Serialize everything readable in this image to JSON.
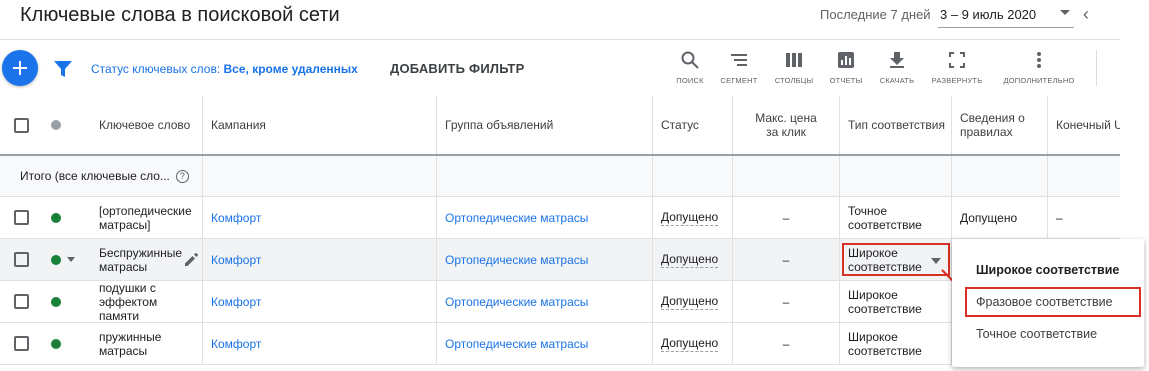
{
  "header": {
    "title": "Ключевые слова в поисковой сети",
    "date_range_label": "Последние 7 дней",
    "date_range_value": "3 – 9 июль 2020"
  },
  "toolbar": {
    "status_label": "Статус ключевых слов: ",
    "status_value": "Все, кроме удаленных",
    "add_filter": "ДОБАВИТЬ ФИЛЬТР",
    "tools": [
      "ПОИСК",
      "СЕГМЕНТ",
      "СТОЛБЦЫ",
      "ОТЧЕТЫ",
      "СКАЧАТЬ",
      "РАЗВЕРНУТЬ",
      "ДОПОЛНИТЕЛЬНО"
    ]
  },
  "table": {
    "headers": {
      "keyword": "Ключевое слово",
      "campaign": "Кампания",
      "ad_group": "Группа объявлений",
      "status": "Статус",
      "max_cpc": "Макс. цена за клик",
      "match_type": "Тип соответствия",
      "policy": "Сведения о правилах",
      "final_url": "Конечный U"
    },
    "total_label": "Итого (все ключевые сло...",
    "rows": [
      {
        "keyword": "[ортопедические матрасы]",
        "campaign": "Комфорт",
        "ad_group": "Ортопедические матрасы",
        "status": "Допущено",
        "max_cpc": "–",
        "match_type": "Точное соответствие",
        "policy": "Допущено",
        "final_url": "–"
      },
      {
        "keyword": "Беспружинные матрасы",
        "campaign": "Комфорт",
        "ad_group": "Ортопедические матрасы",
        "status": "Допущено",
        "max_cpc": "–",
        "match_type": "Широкое соответствие",
        "policy": "",
        "final_url": ""
      },
      {
        "keyword": "подушки с эффектом памяти",
        "campaign": "Комфорт",
        "ad_group": "Ортопедические матрасы",
        "status": "Допущено",
        "max_cpc": "–",
        "match_type": "Широкое соответствие",
        "policy": "",
        "final_url": ""
      },
      {
        "keyword": "пружинные матрасы",
        "campaign": "Комфорт",
        "ad_group": "Ортопедические матрасы",
        "status": "Допущено",
        "max_cpc": "–",
        "match_type": "Широкое соответствие",
        "policy": "",
        "final_url": ""
      }
    ]
  },
  "match_menu": {
    "options": [
      "Широкое соответствие",
      "Фразовое соответствие",
      "Точное соответствие"
    ],
    "selected": "Широкое соответствие",
    "highlighted": "Фразовое соответствие"
  },
  "colors": {
    "accent": "#1a73e8",
    "enabled_dot": "#188038",
    "highlight_box": "#d93025"
  }
}
